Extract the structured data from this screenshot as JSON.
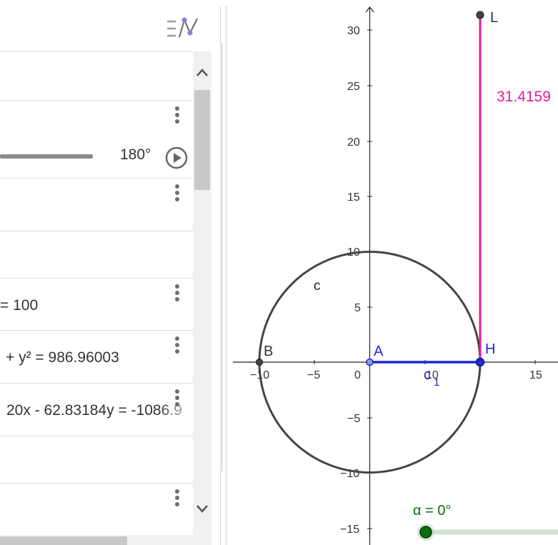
{
  "algebra": {
    "menu_icon": "algebra-view-style-icon",
    "slider_value": "180°",
    "play_icon": "play-icon",
    "expr_circle": "= 100",
    "expr_circle2": "+ y² = 986.96003",
    "expr_line": "20x - 62.83184y = -1086.9",
    "scroll_up_icon": "chevron-up-icon",
    "scroll_down_icon": "chevron-down-icon"
  },
  "graphics": {
    "x_ticks": [
      "−10",
      "−5",
      "0",
      "10",
      "15"
    ],
    "y_ticks": [
      "30",
      "25",
      "20",
      "15",
      "10",
      "5",
      "−5",
      "−10",
      "−15"
    ],
    "point_L": "L",
    "point_H": "H",
    "point_A": "A",
    "point_B": "B",
    "circle_label": "c",
    "segment_label_c": "c",
    "segment_label_sub": "1",
    "length_label": "31.4159",
    "slider_label": "α = 0°",
    "colors": {
      "pink": "#e6199f",
      "blue": "#1f28d2",
      "green": "#0a6e0a",
      "circle": "#444444"
    }
  }
}
